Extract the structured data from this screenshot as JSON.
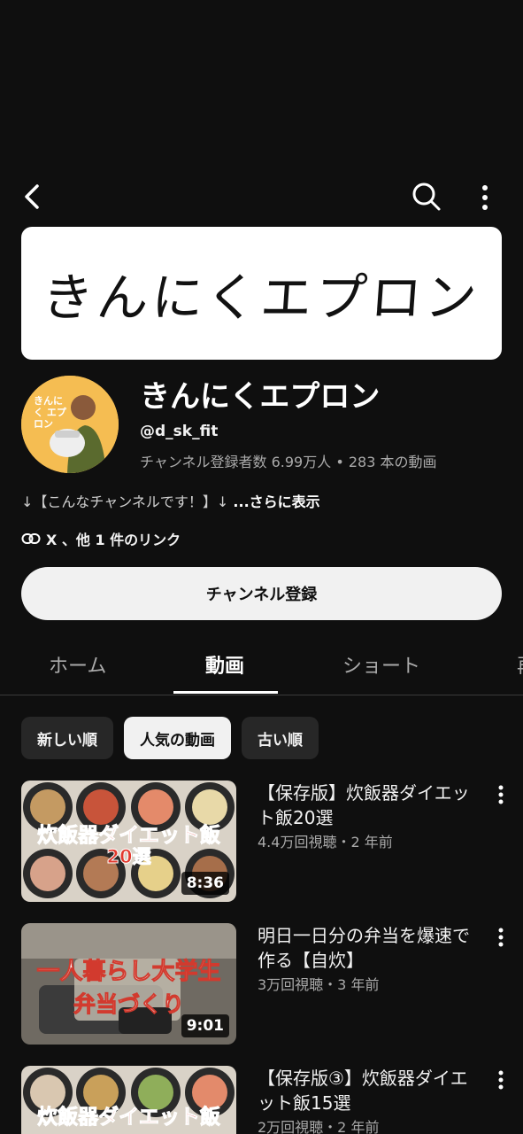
{
  "channel": {
    "banner_text": "きんにくエプロン",
    "title": "きんにくエプロン",
    "handle": "@d_sk_fit",
    "stats": "チャンネル登録者数 6.99万人 • 283 本の動画",
    "avatar_caption": "きんにく エプロン",
    "description": "↓【こんなチャンネルです！】↓ ",
    "description_more": "...さらに表示",
    "links": "X 、他 1 件のリンク",
    "subscribe_label": "チャンネル登録"
  },
  "tabs": [
    {
      "label": "ホーム"
    },
    {
      "label": "動画"
    },
    {
      "label": "ショート"
    },
    {
      "label": "再"
    }
  ],
  "active_tab": "動画",
  "chips": [
    {
      "label": "新しい順"
    },
    {
      "label": "人気の動画"
    },
    {
      "label": "古い順"
    }
  ],
  "selected_chip": "人気の動画",
  "videos": [
    {
      "title": "【保存版】炊飯器ダイエット飯20選",
      "meta": "4.4万回視聴・2 年前",
      "duration": "8:36",
      "thumb_line1": "炊飯器ダイエット飯",
      "thumb_line2": "20選"
    },
    {
      "title": "明日一日分の弁当を爆速で作る【自炊】",
      "meta": "3万回視聴・3 年前",
      "duration": "9:01",
      "thumb_line1": "一人暮らし大学生",
      "thumb_line2": "弁当づくり"
    },
    {
      "title": "【保存版③】炊飯器ダイエット飯15選",
      "meta": "2万回視聴・2 年前",
      "duration": "",
      "thumb_line1": "炊飯器ダイエット飯",
      "thumb_line2": ""
    }
  ],
  "colors": {
    "background": "#0f0f0f",
    "text": "#f1f1f1",
    "secondary_text": "#aaaaaa",
    "chip_bg": "#272727",
    "accent_red": "#e23a2e"
  }
}
